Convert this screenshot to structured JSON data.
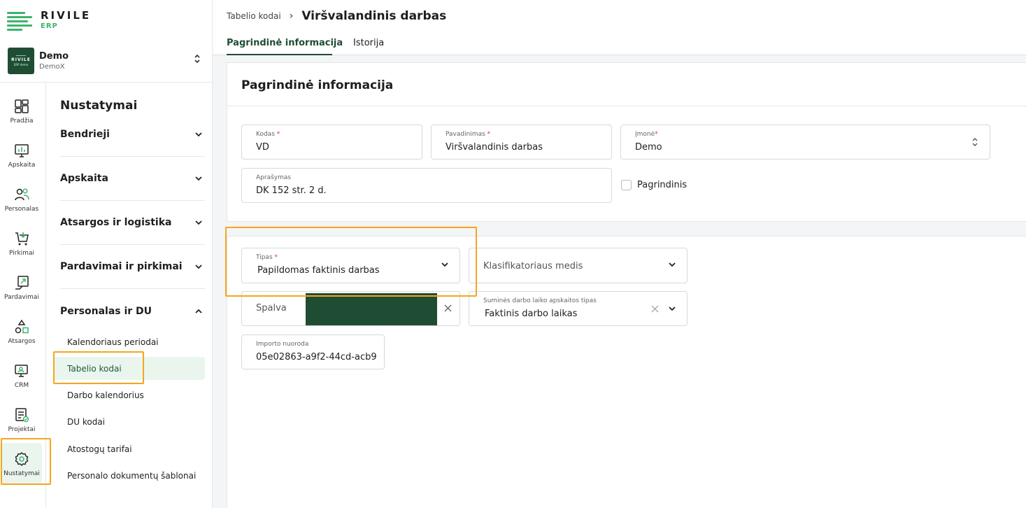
{
  "brand": {
    "name": "RIVILE",
    "sub": "ERP"
  },
  "org": {
    "logo_text": "RIVILE",
    "logo_sub": "ERP demo",
    "name": "Demo",
    "sub": "DemoX",
    "chevron": "⌃⌄"
  },
  "rail": [
    {
      "label": "Pradžia",
      "icon": "dashboard-icon"
    },
    {
      "label": "Apskaita",
      "icon": "chart-icon"
    },
    {
      "label": "Personalas",
      "icon": "people-icon"
    },
    {
      "label": "Pirkimai",
      "icon": "cart-icon"
    },
    {
      "label": "Pardavimai",
      "icon": "sales-icon"
    },
    {
      "label": "Atsargos",
      "icon": "shapes-icon"
    },
    {
      "label": "CRM",
      "icon": "crm-icon"
    },
    {
      "label": "Projektai",
      "icon": "project-icon"
    },
    {
      "label": "Nustatymai",
      "icon": "gear-icon",
      "active": true
    }
  ],
  "menu": {
    "title": "Nustatymai",
    "groups": [
      {
        "label": "Bendrieji",
        "chevron": "⌄"
      },
      {
        "label": "Apskaita",
        "chevron": "⌄"
      },
      {
        "label": "Atsargos ir logistika",
        "chevron": "⌄"
      },
      {
        "label": "Pardavimai ir pirkimai",
        "chevron": "⌄"
      },
      {
        "label": "Personalas ir DU",
        "chevron": "⌃"
      }
    ],
    "sub_items": [
      {
        "label": "Kalendoriaus periodai"
      },
      {
        "label": "Tabelio kodai",
        "active": true
      },
      {
        "label": "Darbo kalendorius"
      },
      {
        "label": "DU kodai"
      },
      {
        "label": "Atostogų tarifai"
      },
      {
        "label": "Personalo dokumentų šablonai"
      }
    ]
  },
  "breadcrumb": {
    "parent": "Tabelio kodai",
    "separator": "›",
    "title": "Viršvalandinis darbas"
  },
  "tabs": [
    {
      "label": "Pagrindinė informacija",
      "active": true
    },
    {
      "label": "Istorija"
    }
  ],
  "card1": {
    "title": "Pagrindinė informacija",
    "kodas": {
      "label": "Kodas",
      "required": "*",
      "value": "VD"
    },
    "pavadinimas": {
      "label": "Pavadinimas",
      "required": "*",
      "value": "Viršvalandinis darbas"
    },
    "imone": {
      "label": "Įmonė",
      "required": "*",
      "value": "Demo"
    },
    "aprasymas": {
      "label": "Aprašymas",
      "value": "DK 152 str. 2 d."
    },
    "pagrindinis": {
      "label": "Pagrindinis",
      "checked": false
    }
  },
  "card2": {
    "tipas": {
      "label": "Tipas",
      "required": "*",
      "value": "Papildomas faktinis darbas"
    },
    "klasifikatorius": {
      "placeholder": "Klasifikatoriaus medis"
    },
    "spalva": {
      "placeholder": "Spalva",
      "color": "#1f4d33"
    },
    "sumines": {
      "label": "Suminės darbo laiko apskaitos tipas",
      "value": "Faktinis darbo laikas"
    },
    "importo": {
      "label": "Importo nuoroda",
      "value": "05e02863-a9f2-44cd-acb9"
    }
  },
  "colors": {
    "accent": "#1f4d33",
    "brand_green": "#3db46d",
    "highlight": "#f5a51e",
    "required": "#dd3333"
  }
}
